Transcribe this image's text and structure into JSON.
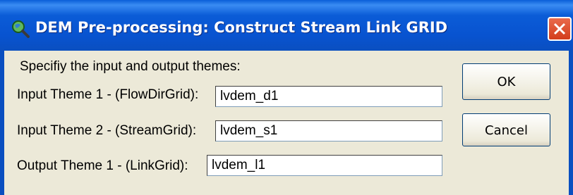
{
  "window": {
    "title": "DEM Pre-processing: Construct Stream Link GRID",
    "icon": "search-globe-icon"
  },
  "dialog": {
    "prompt": "Specifiy the input and output themes:",
    "fields": [
      {
        "label": "Input Theme 1 - (FlowDirGrid):",
        "value": "lvdem_d1"
      },
      {
        "label": "Input Theme 2 - (StreamGrid):",
        "value": "lvdem_s1"
      },
      {
        "label": "Output Theme 1 - (LinkGrid):",
        "value": "lvdem_l1"
      }
    ],
    "buttons": {
      "ok": "OK",
      "cancel": "Cancel"
    }
  }
}
